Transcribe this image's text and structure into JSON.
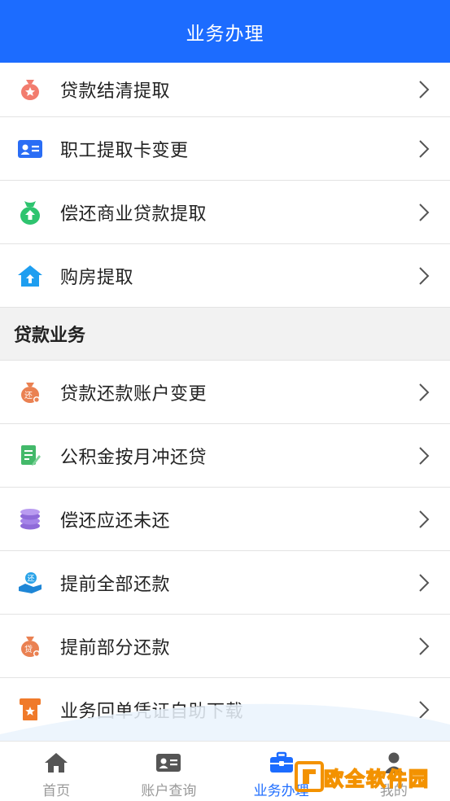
{
  "header": {
    "title": "业务办理"
  },
  "list_top": [
    {
      "label": "贷款结清提取",
      "icon": "money-bag-star-icon"
    },
    {
      "label": "职工提取卡变更",
      "icon": "id-card-icon"
    },
    {
      "label": "偿还商业贷款提取",
      "icon": "green-money-bag-icon"
    },
    {
      "label": "购房提取",
      "icon": "house-up-icon"
    }
  ],
  "section": {
    "title": "贷款业务"
  },
  "list_loan": [
    {
      "label": "贷款还款账户变更",
      "icon": "repay-bag-icon"
    },
    {
      "label": "公积金按月冲还贷",
      "icon": "document-pen-icon"
    },
    {
      "label": "偿还应还未还",
      "icon": "coin-stack-icon"
    },
    {
      "label": "提前全部还款",
      "icon": "hand-coin-icon"
    },
    {
      "label": "提前部分还款",
      "icon": "loan-bag-icon"
    },
    {
      "label": "业务回单凭证自助下载",
      "icon": "receipt-download-icon"
    }
  ],
  "icon_glyphs": {
    "repay": "还",
    "loan": "贷"
  },
  "tabs": [
    {
      "label": "首页",
      "icon": "home-icon"
    },
    {
      "label": "账户查询",
      "icon": "account-card-icon"
    },
    {
      "label": "业务办理",
      "icon": "briefcase-icon",
      "active": true
    },
    {
      "label": "我的",
      "icon": "person-icon"
    }
  ],
  "watermark": {
    "text": "欧全软件园"
  },
  "colors": {
    "primary": "#1c6cff",
    "inactive": "#999999"
  }
}
